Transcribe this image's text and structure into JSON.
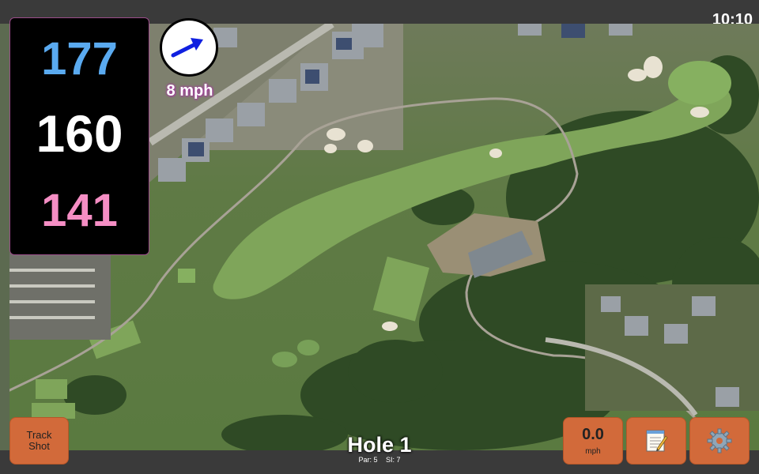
{
  "clock": "10:10",
  "distances": {
    "back": "177",
    "middle": "160",
    "front": "141",
    "back_color": "#5aaaf0",
    "middle_color": "#ffffff",
    "front_color": "#f58ec4"
  },
  "wind": {
    "indicator_icon": "wind-direction-arrow-icon",
    "speed_label": "8 mph",
    "arrow_color": "#1020e0"
  },
  "buttons": {
    "track_shot_line1": "Track",
    "track_shot_line2": "Shot",
    "wind_value": "0.0",
    "wind_unit": "mph",
    "notes_icon": "notepad-icon",
    "settings_icon": "gear-icon",
    "button_color": "#d26a3a"
  },
  "hole": {
    "title": "Hole 1",
    "par": "Par: 5",
    "stroke_index": "SI: 7"
  },
  "map": {
    "type": "aerial-satellite-golf-course"
  }
}
